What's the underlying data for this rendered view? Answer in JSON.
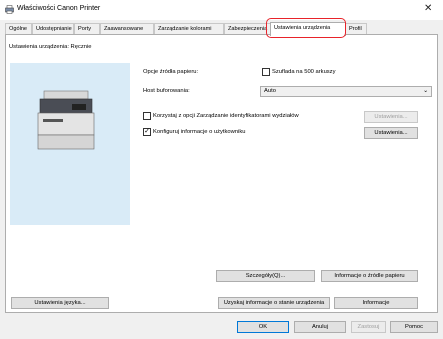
{
  "window": {
    "title": "Właściwości Canon Printer",
    "close_glyph": "✕"
  },
  "tabs": [
    {
      "label": "Ogólne"
    },
    {
      "label": "Udostępnianie"
    },
    {
      "label": "Porty"
    },
    {
      "label": "Zaawansowane"
    },
    {
      "label": "Zarządzanie kolorami"
    },
    {
      "label": "Zabezpieczenia"
    },
    {
      "label": "Ustawienia urządzenia"
    },
    {
      "label": "Profil"
    }
  ],
  "panel": {
    "settings_label": "Ustawienia urządzenia: Ręcznie",
    "paper_source": {
      "label": "Opcje źródła papieru:",
      "option_label": "Szuflada na 500 arkuszy",
      "checked": false
    },
    "spool": {
      "label": "Host buforowania:",
      "value": "Auto"
    },
    "dept_id": {
      "label": "Korzystaj z opcji Zarządzanie identyfikatorami wydziałów",
      "checked": false,
      "button": "Ustawienia..."
    },
    "user_info": {
      "label": "Konfiguruj informacje o użytkowniku",
      "checked": true,
      "button": "Ustawienia..."
    },
    "details_button": "Szczegóły(Q)...",
    "paper_source_info_button": "Informacje o źródle papieru",
    "language_button": "Ustawienia języka...",
    "get_status_button": "Uzyskaj informacje o stanie urządzenia",
    "info_button": "Informacje"
  },
  "footer": {
    "ok": "OK",
    "cancel": "Anuluj",
    "apply": "Zastosuj",
    "help": "Pomoc"
  },
  "icons": {
    "app": "printer-icon",
    "check": "✓",
    "dropdown": "⌄"
  },
  "colors": {
    "highlight": "#e8232a",
    "preview_bg": "#d9ebf7"
  }
}
